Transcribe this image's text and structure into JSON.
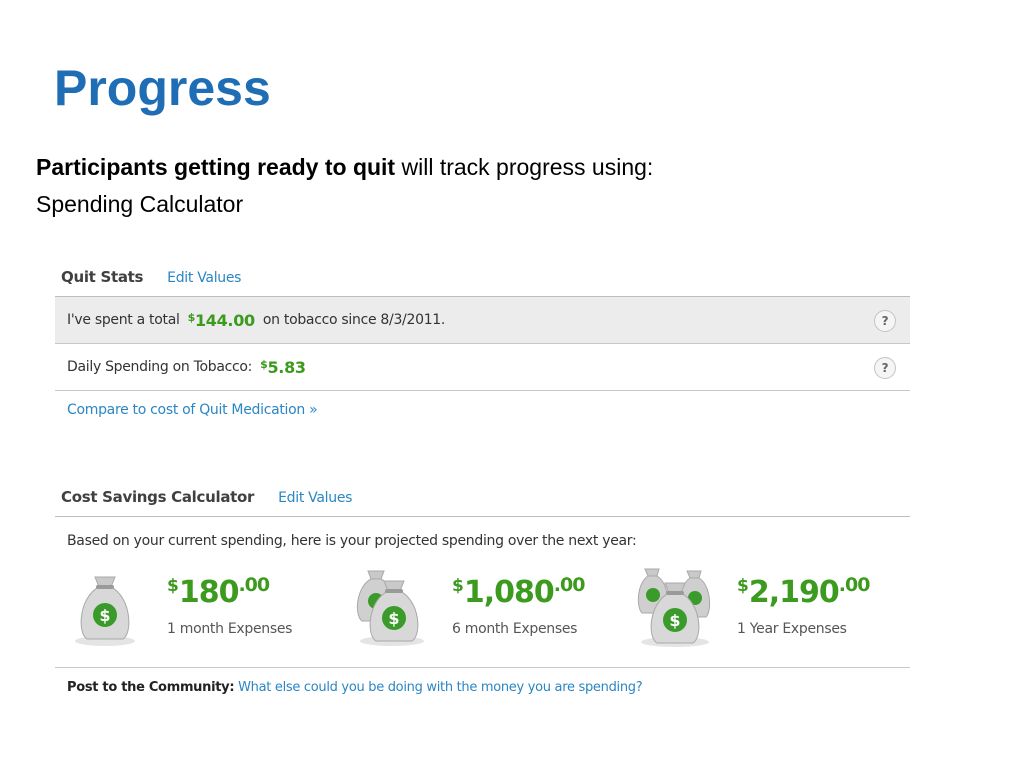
{
  "slide": {
    "title": "Progress",
    "intro_bold": "Participants getting ready to quit",
    "intro_rest": " will track progress using:",
    "subtitle": "Spending Calculator"
  },
  "quit_stats": {
    "title": "Quit Stats",
    "edit_label": "Edit Values",
    "total_prefix": "I've spent a total",
    "total_currency": "$",
    "total_amount": "144.00",
    "total_suffix": "on tobacco since 8/3/2011.",
    "daily_label": "Daily Spending on Tobacco:",
    "daily_currency": "$",
    "daily_amount": "5.83",
    "help_symbol": "?",
    "compare_link": "Compare to cost of Quit Medication »"
  },
  "cost_savings": {
    "title": "Cost Savings Calculator",
    "edit_label": "Edit Values",
    "intro": "Based on your current spending, here is your projected spending over the next year:",
    "projections": [
      {
        "currency": "$",
        "whole": "180",
        "cents": ".00",
        "label": "1 month Expenses",
        "icon": "money-bag-single-icon"
      },
      {
        "currency": "$",
        "whole": "1,080",
        "cents": ".00",
        "label": "6 month Expenses",
        "icon": "money-bag-pair-icon"
      },
      {
        "currency": "$",
        "whole": "2,190",
        "cents": ".00",
        "label": "1 Year Expenses",
        "icon": "money-bag-group-icon"
      }
    ]
  },
  "community": {
    "label": "Post to the Community:",
    "link": "What else could you be doing with the money you are spending?"
  },
  "colors": {
    "title_blue": "#1f6db5",
    "money_green": "#3c9a1e",
    "link_blue": "#2a86c4"
  }
}
